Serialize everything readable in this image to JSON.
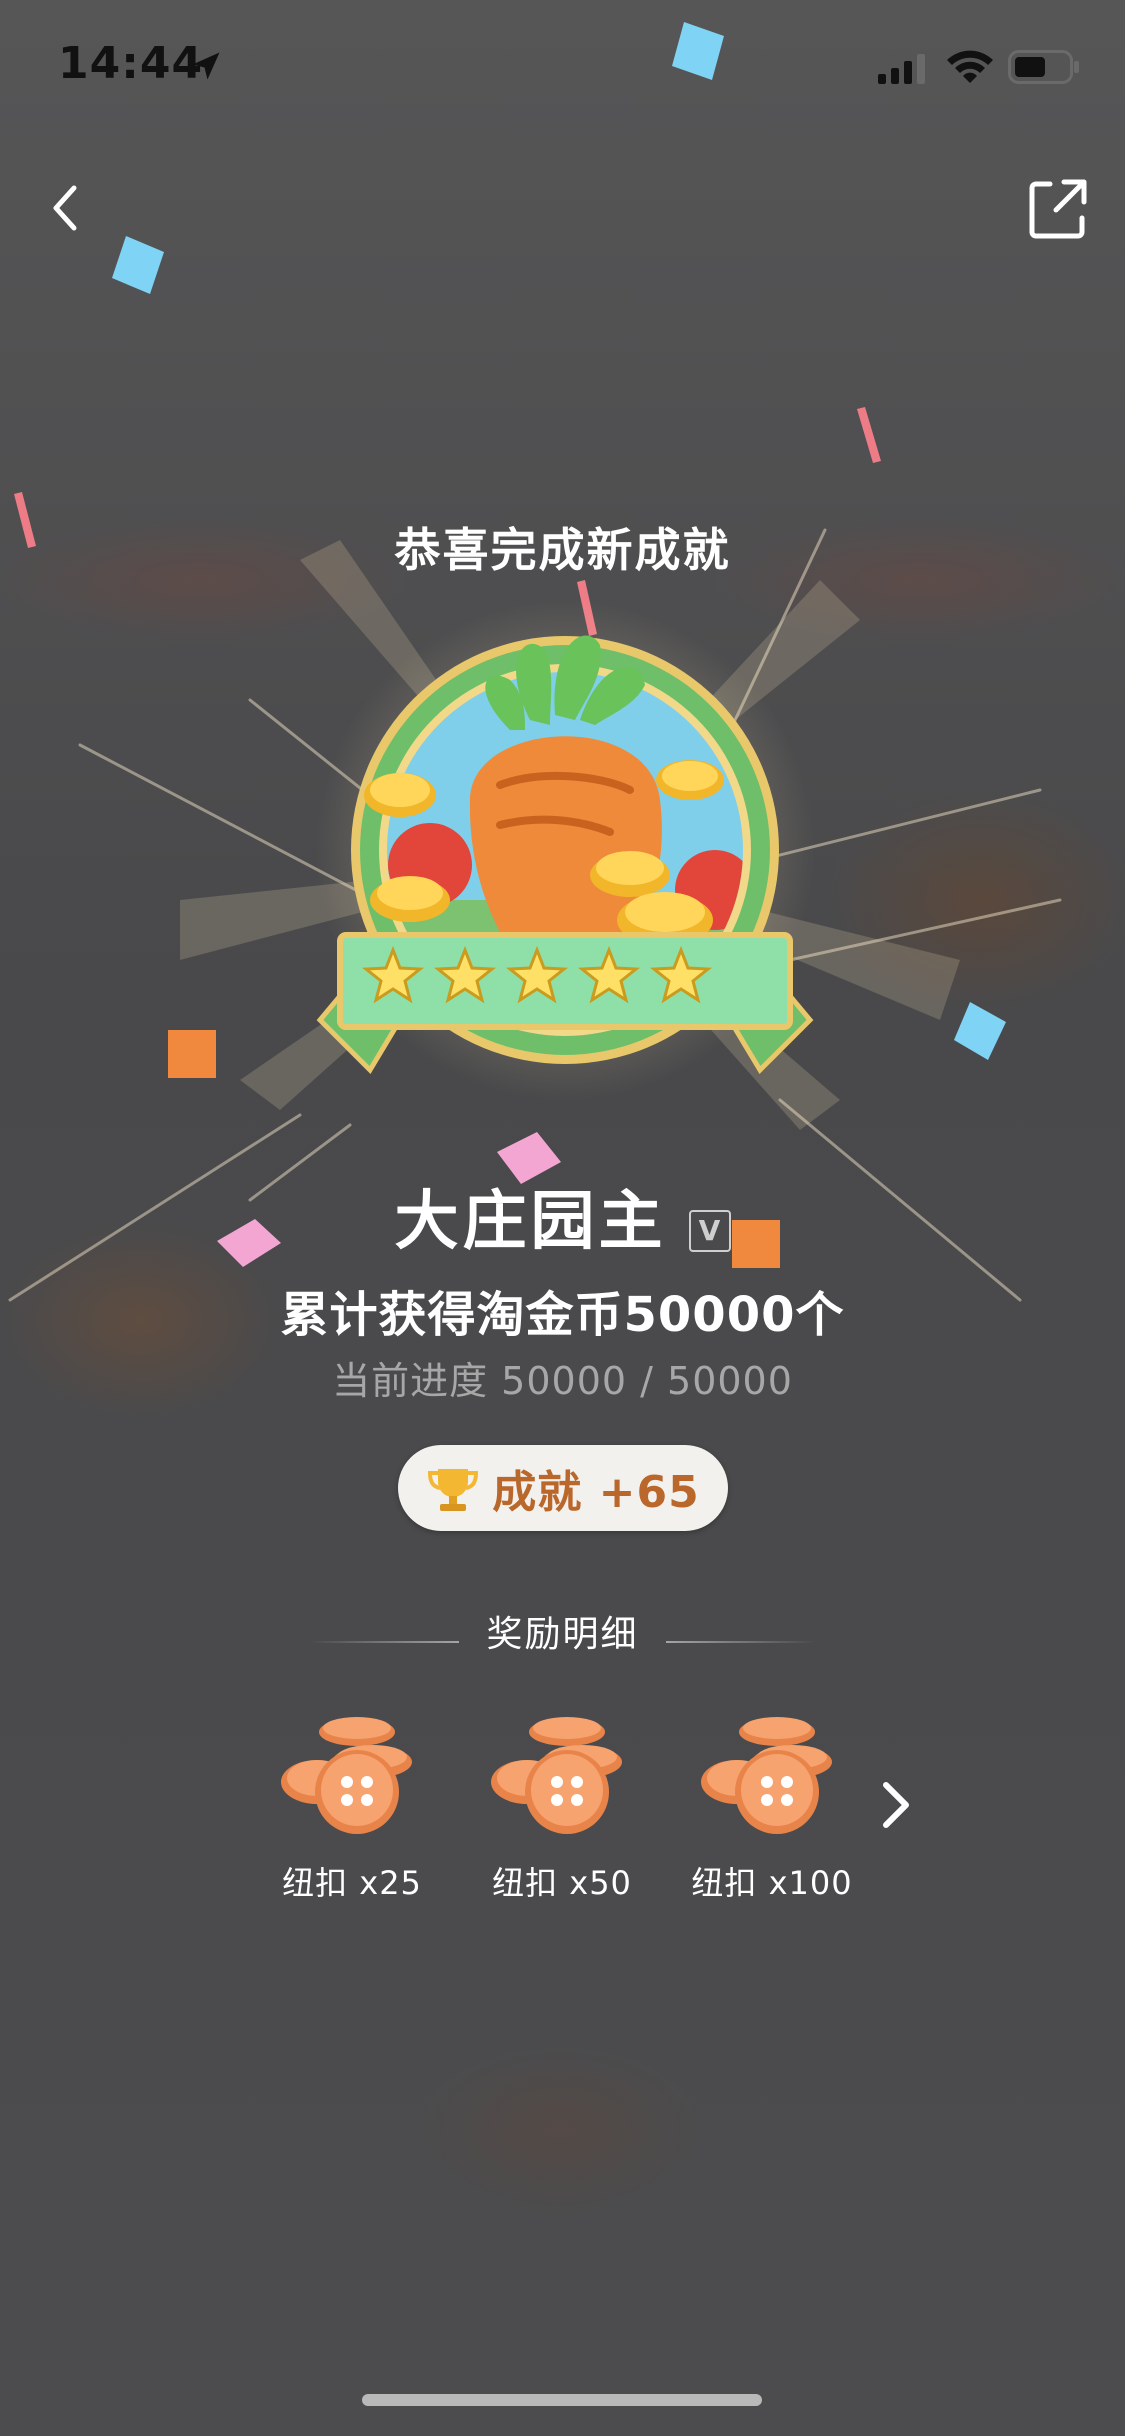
{
  "status_bar": {
    "time": "14:44",
    "location_icon": "location-arrow-icon",
    "signal_icon": "cellular-signal-icon",
    "wifi_icon": "wifi-icon",
    "battery_icon": "battery-icon"
  },
  "nav": {
    "back_icon": "chevron-left-icon",
    "share_icon": "share-external-icon"
  },
  "headline": "恭喜完成新成就",
  "achievement": {
    "name": "大庄园主",
    "level_tag": "V",
    "description": "累计获得淘金币50000个",
    "progress_text": "当前进度 50000 / 50000",
    "progress_current": 50000,
    "progress_total": 50000,
    "stars": 5,
    "badge_icon": "carrot-medal-icon"
  },
  "points": {
    "icon": "trophy-icon",
    "label": "成就 +65"
  },
  "rewards": {
    "title": "奖励明细",
    "items": [
      {
        "icon": "button-coins-icon",
        "label": "纽扣 x25"
      },
      {
        "icon": "button-coins-icon",
        "label": "纽扣 x50"
      },
      {
        "icon": "button-coins-icon",
        "label": "纽扣 x100"
      }
    ],
    "next_icon": "chevron-right-icon"
  },
  "colors": {
    "points_text": "#b9672b",
    "pill_bg": "#f3f1ee",
    "background": "#4b4b4d",
    "badge_green": "#6fbf6a",
    "carrot_orange": "#ef8a3a"
  }
}
